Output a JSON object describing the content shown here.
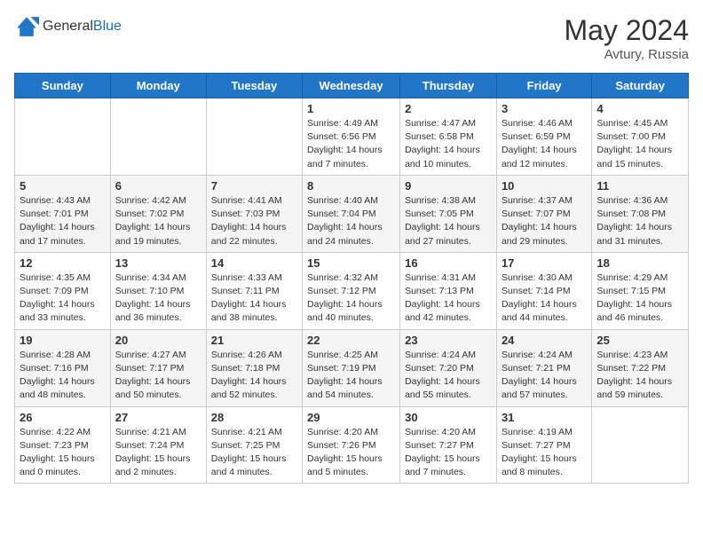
{
  "header": {
    "logo_general": "General",
    "logo_blue": "Blue",
    "month": "May 2024",
    "location": "Avtury, Russia"
  },
  "columns": [
    "Sunday",
    "Monday",
    "Tuesday",
    "Wednesday",
    "Thursday",
    "Friday",
    "Saturday"
  ],
  "weeks": [
    [
      {
        "day": "",
        "info": ""
      },
      {
        "day": "",
        "info": ""
      },
      {
        "day": "",
        "info": ""
      },
      {
        "day": "1",
        "info": "Sunrise: 4:49 AM\nSunset: 6:56 PM\nDaylight: 14 hours and 7 minutes."
      },
      {
        "day": "2",
        "info": "Sunrise: 4:47 AM\nSunset: 6:58 PM\nDaylight: 14 hours and 10 minutes."
      },
      {
        "day": "3",
        "info": "Sunrise: 4:46 AM\nSunset: 6:59 PM\nDaylight: 14 hours and 12 minutes."
      },
      {
        "day": "4",
        "info": "Sunrise: 4:45 AM\nSunset: 7:00 PM\nDaylight: 14 hours and 15 minutes."
      }
    ],
    [
      {
        "day": "5",
        "info": "Sunrise: 4:43 AM\nSunset: 7:01 PM\nDaylight: 14 hours and 17 minutes."
      },
      {
        "day": "6",
        "info": "Sunrise: 4:42 AM\nSunset: 7:02 PM\nDaylight: 14 hours and 19 minutes."
      },
      {
        "day": "7",
        "info": "Sunrise: 4:41 AM\nSunset: 7:03 PM\nDaylight: 14 hours and 22 minutes."
      },
      {
        "day": "8",
        "info": "Sunrise: 4:40 AM\nSunset: 7:04 PM\nDaylight: 14 hours and 24 minutes."
      },
      {
        "day": "9",
        "info": "Sunrise: 4:38 AM\nSunset: 7:05 PM\nDaylight: 14 hours and 27 minutes."
      },
      {
        "day": "10",
        "info": "Sunrise: 4:37 AM\nSunset: 7:07 PM\nDaylight: 14 hours and 29 minutes."
      },
      {
        "day": "11",
        "info": "Sunrise: 4:36 AM\nSunset: 7:08 PM\nDaylight: 14 hours and 31 minutes."
      }
    ],
    [
      {
        "day": "12",
        "info": "Sunrise: 4:35 AM\nSunset: 7:09 PM\nDaylight: 14 hours and 33 minutes."
      },
      {
        "day": "13",
        "info": "Sunrise: 4:34 AM\nSunset: 7:10 PM\nDaylight: 14 hours and 36 minutes."
      },
      {
        "day": "14",
        "info": "Sunrise: 4:33 AM\nSunset: 7:11 PM\nDaylight: 14 hours and 38 minutes."
      },
      {
        "day": "15",
        "info": "Sunrise: 4:32 AM\nSunset: 7:12 PM\nDaylight: 14 hours and 40 minutes."
      },
      {
        "day": "16",
        "info": "Sunrise: 4:31 AM\nSunset: 7:13 PM\nDaylight: 14 hours and 42 minutes."
      },
      {
        "day": "17",
        "info": "Sunrise: 4:30 AM\nSunset: 7:14 PM\nDaylight: 14 hours and 44 minutes."
      },
      {
        "day": "18",
        "info": "Sunrise: 4:29 AM\nSunset: 7:15 PM\nDaylight: 14 hours and 46 minutes."
      }
    ],
    [
      {
        "day": "19",
        "info": "Sunrise: 4:28 AM\nSunset: 7:16 PM\nDaylight: 14 hours and 48 minutes."
      },
      {
        "day": "20",
        "info": "Sunrise: 4:27 AM\nSunset: 7:17 PM\nDaylight: 14 hours and 50 minutes."
      },
      {
        "day": "21",
        "info": "Sunrise: 4:26 AM\nSunset: 7:18 PM\nDaylight: 14 hours and 52 minutes."
      },
      {
        "day": "22",
        "info": "Sunrise: 4:25 AM\nSunset: 7:19 PM\nDaylight: 14 hours and 54 minutes."
      },
      {
        "day": "23",
        "info": "Sunrise: 4:24 AM\nSunset: 7:20 PM\nDaylight: 14 hours and 55 minutes."
      },
      {
        "day": "24",
        "info": "Sunrise: 4:24 AM\nSunset: 7:21 PM\nDaylight: 14 hours and 57 minutes."
      },
      {
        "day": "25",
        "info": "Sunrise: 4:23 AM\nSunset: 7:22 PM\nDaylight: 14 hours and 59 minutes."
      }
    ],
    [
      {
        "day": "26",
        "info": "Sunrise: 4:22 AM\nSunset: 7:23 PM\nDaylight: 15 hours and 0 minutes."
      },
      {
        "day": "27",
        "info": "Sunrise: 4:21 AM\nSunset: 7:24 PM\nDaylight: 15 hours and 2 minutes."
      },
      {
        "day": "28",
        "info": "Sunrise: 4:21 AM\nSunset: 7:25 PM\nDaylight: 15 hours and 4 minutes."
      },
      {
        "day": "29",
        "info": "Sunrise: 4:20 AM\nSunset: 7:26 PM\nDaylight: 15 hours and 5 minutes."
      },
      {
        "day": "30",
        "info": "Sunrise: 4:20 AM\nSunset: 7:27 PM\nDaylight: 15 hours and 7 minutes."
      },
      {
        "day": "31",
        "info": "Sunrise: 4:19 AM\nSunset: 7:27 PM\nDaylight: 15 hours and 8 minutes."
      },
      {
        "day": "",
        "info": ""
      }
    ]
  ]
}
